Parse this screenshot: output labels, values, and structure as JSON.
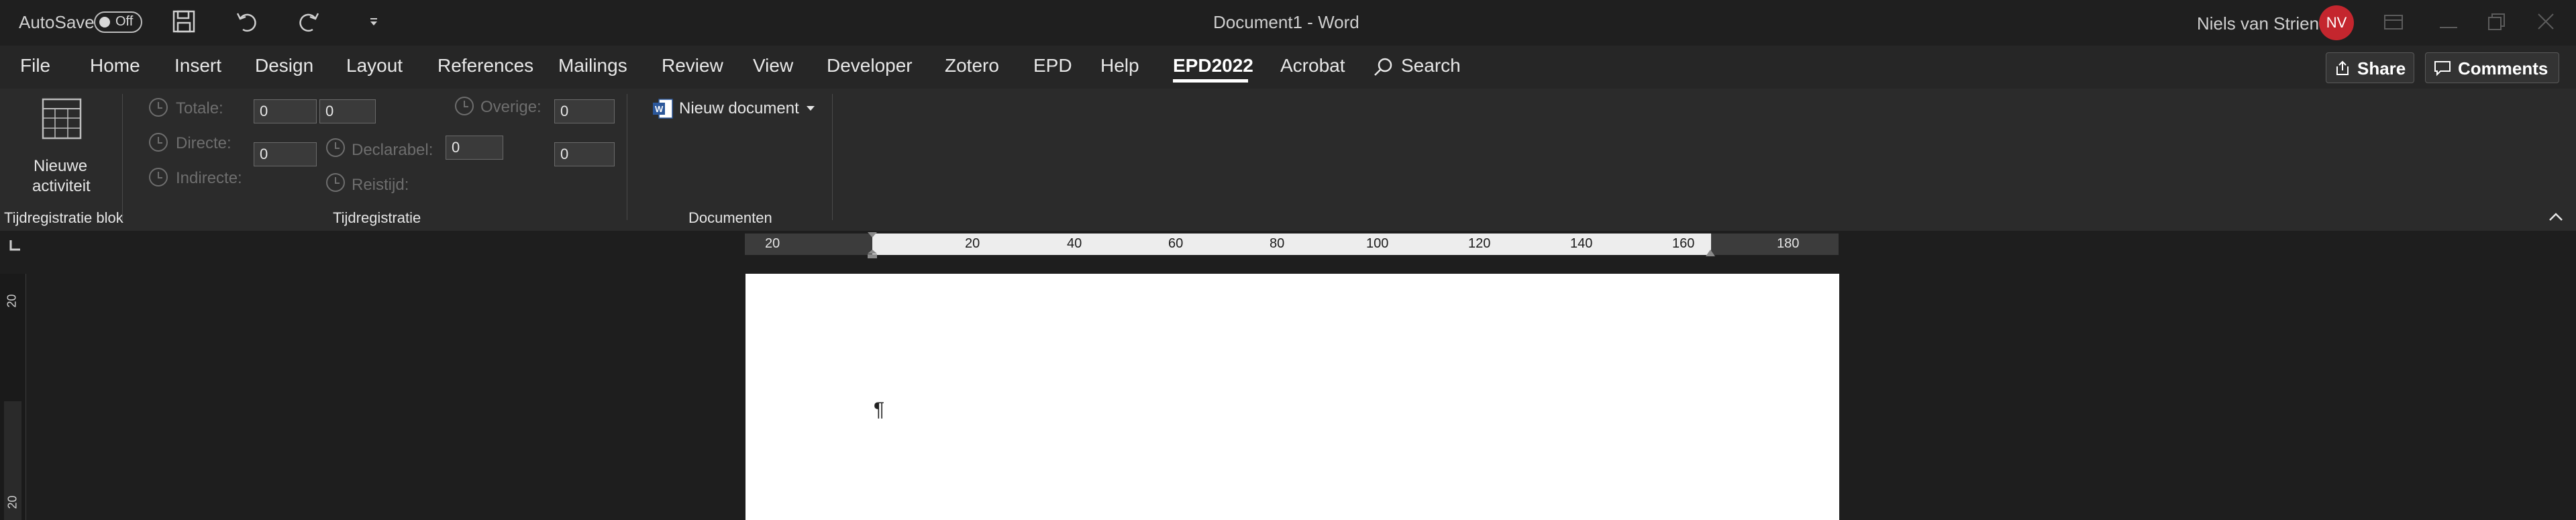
{
  "titlebar": {
    "autosave_label": "AutoSave",
    "autosave_state": "Off",
    "document_title": "Document1  -  Word",
    "user_name": "Niels van Strien",
    "user_initials": "NV",
    "avatar_color": "#c4262e",
    "quick_access_icons": [
      "save-icon",
      "undo-icon",
      "redo-icon",
      "customize-dropdown-icon"
    ],
    "window_icons": [
      "ribbon-display-icon",
      "minimize-icon",
      "restore-icon",
      "close-icon"
    ]
  },
  "tabs": [
    {
      "label": "File"
    },
    {
      "label": "Home"
    },
    {
      "label": "Insert"
    },
    {
      "label": "Design"
    },
    {
      "label": "Layout"
    },
    {
      "label": "References"
    },
    {
      "label": "Mailings"
    },
    {
      "label": "Review"
    },
    {
      "label": "View"
    },
    {
      "label": "Developer"
    },
    {
      "label": "Zotero"
    },
    {
      "label": "EPD"
    },
    {
      "label": "Help"
    },
    {
      "label": "EPD2022",
      "active": true
    },
    {
      "label": "Acrobat"
    }
  ],
  "search_label": "Search",
  "share_label": "Share",
  "comments_label": "Comments",
  "ribbon": {
    "group_tijd_blok": {
      "button_label_line1": "Nieuwe",
      "button_label_line2": "activiteit",
      "group_label": "Tijdregistratie blok"
    },
    "group_tijd": {
      "totale_label": "Totale:",
      "directe_label": "Directe:",
      "indirecte_label": "Indirecte:",
      "declarabel_label": "Declarabel:",
      "reistijd_label": "Reistijd:",
      "overige_label": "Overige:",
      "totale_value_1": "0",
      "totale_value_2": "0",
      "directe_value": "0",
      "declarabel_value": "0",
      "overige_value": "0",
      "reistijd_value": "0",
      "group_label": "Tijdregistratie"
    },
    "group_docs": {
      "nieuw_document_label": "Nieuw document",
      "group_label": "Documenten"
    }
  },
  "ruler": {
    "labels": [
      "20",
      "20",
      "40",
      "60",
      "80",
      "100",
      "120",
      "140",
      "160",
      "180"
    ]
  },
  "vertical_ruler": {
    "labels": [
      "20",
      "20"
    ]
  },
  "document": {
    "pilcrow": "¶"
  },
  "colors": {
    "background": "#252525",
    "titlebar": "#1f1f1f",
    "ribbon": "#2b2b2b",
    "page": "#ffffff"
  }
}
